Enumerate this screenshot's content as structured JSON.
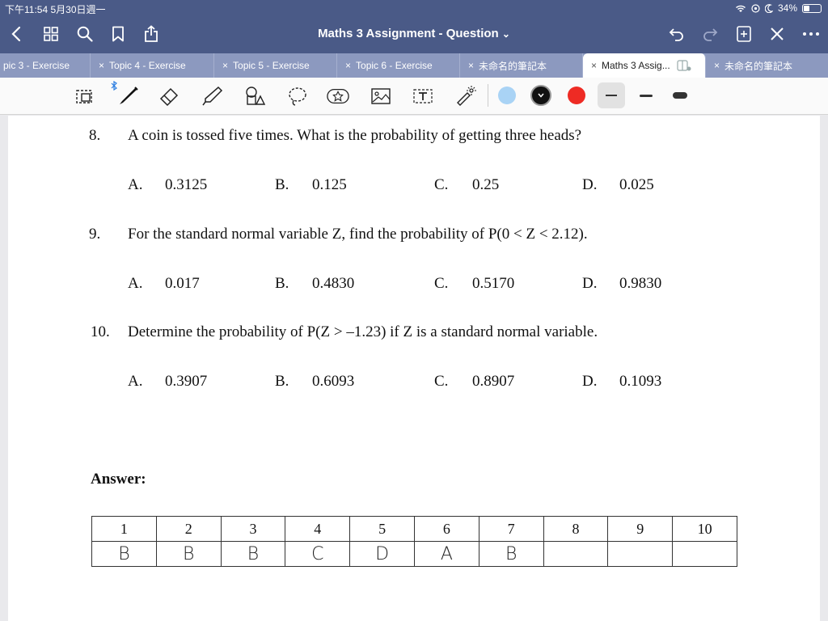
{
  "status": {
    "time": "下午11:54  5月30日週一",
    "battery": "34%"
  },
  "nav": {
    "title": "Maths 3 Assignment - Question",
    "title_chevron": "⌄"
  },
  "tabs": [
    {
      "label": "pic 3 - Exercise",
      "closable": false
    },
    {
      "label": "Topic 4 - Exercise",
      "closable": true
    },
    {
      "label": "Topic 5 - Exercise",
      "closable": true
    },
    {
      "label": "Topic 6 - Exercise",
      "closable": true
    },
    {
      "label": "未命名的筆記本",
      "closable": true
    },
    {
      "label": "Maths 3 Assig...",
      "closable": true,
      "active": true
    },
    {
      "label": "未命名的筆記本",
      "closable": true
    }
  ],
  "colors": {
    "light_blue": "#a9d3f5",
    "black": "#111111",
    "red": "#ee2b24",
    "bar_blue": "#4a5a87",
    "tab_blue": "#8c99bf"
  },
  "icons": [
    "back-icon",
    "grid-icon",
    "search-icon",
    "bookmark-icon",
    "share-icon",
    "undo-icon",
    "redo-icon",
    "add-page-icon",
    "close-icon",
    "more-icon",
    "lasso-select-icon",
    "bluetooth-icon",
    "pen-icon",
    "eraser-icon",
    "highlighter-icon",
    "shapes-icon",
    "lasso-icon",
    "sticker-icon",
    "image-icon",
    "text-icon",
    "laser-pointer-icon"
  ],
  "questions": [
    {
      "number": "8.",
      "text": "A coin is tossed five times. What is the probability of getting three heads?",
      "options": [
        {
          "letter": "A.",
          "value": "0.3125"
        },
        {
          "letter": "B.",
          "value": "0.125"
        },
        {
          "letter": "C.",
          "value": "0.25"
        },
        {
          "letter": "D.",
          "value": "0.025"
        }
      ]
    },
    {
      "number": "9.",
      "text": "For the standard normal variable Z, find the probability of P(0 < Z < 2.12).",
      "options": [
        {
          "letter": "A.",
          "value": "0.017"
        },
        {
          "letter": "B.",
          "value": "0.4830"
        },
        {
          "letter": "C.",
          "value": "0.5170"
        },
        {
          "letter": "D.",
          "value": "0.9830"
        }
      ]
    },
    {
      "number": "10.",
      "text": "Determine the probability of P(Z > –1.23) if Z is a standard normal variable.",
      "options": [
        {
          "letter": "A.",
          "value": "0.3907"
        },
        {
          "letter": "B.",
          "value": "0.6093"
        },
        {
          "letter": "C.",
          "value": "0.8907"
        },
        {
          "letter": "D.",
          "value": "0.1093"
        }
      ]
    }
  ],
  "answer": {
    "label": "Answer:",
    "headers": [
      "1",
      "2",
      "3",
      "4",
      "5",
      "6",
      "7",
      "8",
      "9",
      "10"
    ],
    "handwritten": [
      "B",
      "B",
      "B",
      "C",
      "D",
      "A",
      "B",
      "",
      "",
      ""
    ]
  }
}
